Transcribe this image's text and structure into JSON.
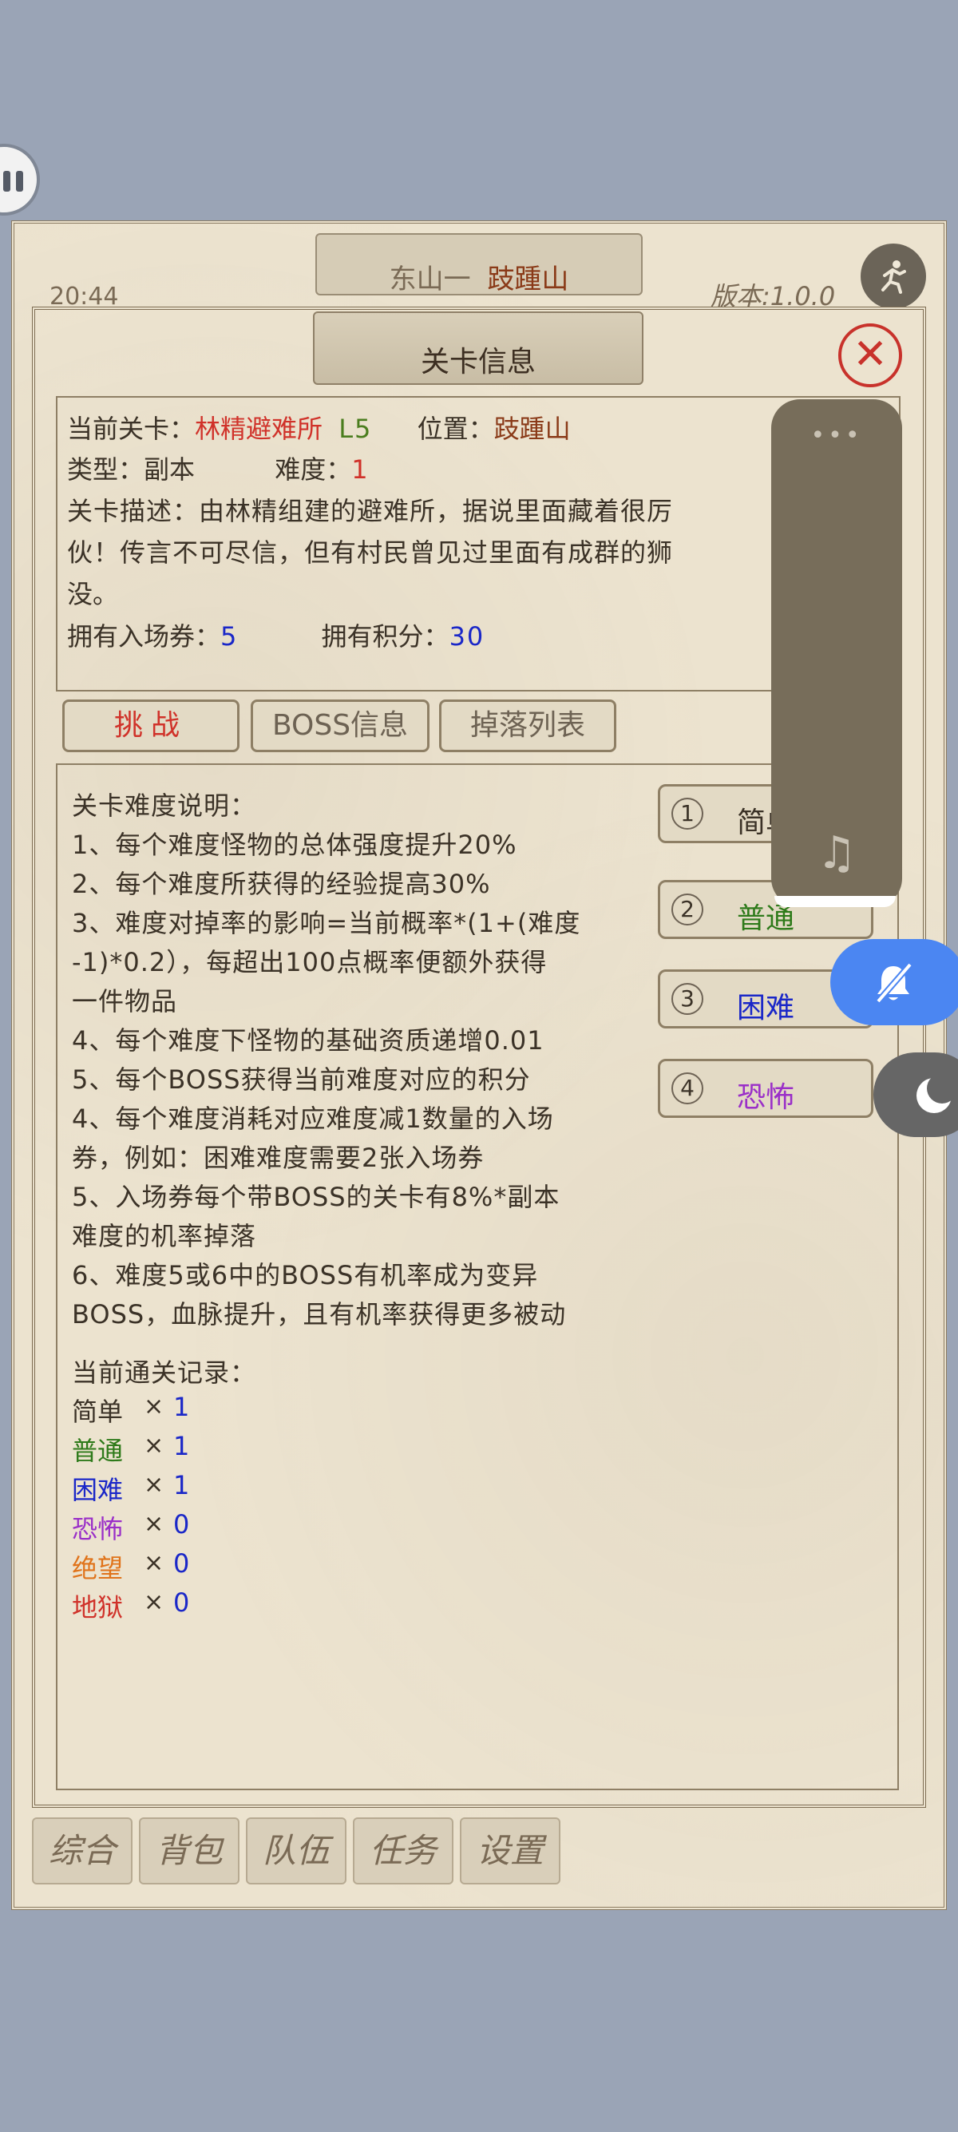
{
  "back_window": {
    "title_part1": "东山一",
    "title_part2": "跂踵山",
    "time": "20:44",
    "version": "版本:1.0.0",
    "nav": [
      "综合",
      "背包",
      "队伍",
      "任务",
      "设置"
    ]
  },
  "dialog": {
    "title": "关卡信息",
    "info": {
      "current_stage_label": "当前关卡：",
      "current_stage_name": "林精避难所",
      "current_stage_level": "L5",
      "location_label": "位置：",
      "location_value": "跂踵山",
      "type_label": "类型：",
      "type_value": "副本",
      "difficulty_label": "难度：",
      "difficulty_value": "1",
      "desc_line1": "关卡描述：由林精组建的避难所，据说里面藏着很厉",
      "desc_line2": "伙！传言不可尽信，但有村民曾见过里面有成群的狮",
      "desc_line3": "没。",
      "tickets_label": "拥有入场券：",
      "tickets_value": "5",
      "points_label": "拥有积分：",
      "points_value": "30"
    },
    "tabs": {
      "challenge": "挑战",
      "boss_info": "BOSS信息",
      "drops": "掉落列表"
    },
    "rules_title": "关卡难度说明：",
    "rules": [
      "1、每个难度怪物的总体强度提升20%",
      "2、每个难度所获得的经验提高30%",
      "3、难度对掉率的影响=当前概率*(1+(难度",
      "-1)*0.2），每超出100点概率便额外获得",
      "一件物品",
      "4、每个难度下怪物的基础资质递增0.01",
      "5、每个BOSS获得当前难度对应的积分",
      "4、每个难度消耗对应难度减1数量的入场",
      "券，例如：困难难度需要2张入场券",
      "5、入场券每个带BOSS的关卡有8%*副本",
      "难度的机率掉落",
      "6、难度5或6中的BOSS有机率成为变异",
      "BOSS，血脉提升，且有机率获得更多被动"
    ],
    "records_title": "当前通关记录：",
    "times_symbol": "×",
    "records": [
      {
        "label": "简单",
        "value": "1",
        "color": "#3b3227"
      },
      {
        "label": "普通",
        "value": "1",
        "color": "#2e7a1a"
      },
      {
        "label": "困难",
        "value": "1",
        "color": "#1a27c8"
      },
      {
        "label": "恐怖",
        "value": "0",
        "color": "#9a2fc8"
      },
      {
        "label": "绝望",
        "value": "0",
        "color": "#e0731a"
      },
      {
        "label": "地狱",
        "value": "0",
        "color": "#d0322a"
      }
    ],
    "difficulties": [
      {
        "num": "1",
        "label": "简单",
        "color": "#3b3227"
      },
      {
        "num": "2",
        "label": "普通",
        "color": "#2e7a1a"
      },
      {
        "num": "3",
        "label": "困难",
        "color": "#1a27c8"
      },
      {
        "num": "4",
        "label": "恐怖",
        "color": "#9a2fc8"
      }
    ]
  },
  "overlay": {
    "menu_dots": "•••",
    "music_icon": "music-note-icon",
    "mute_icon": "bell-off-icon",
    "moon_icon": "moon-icon"
  }
}
